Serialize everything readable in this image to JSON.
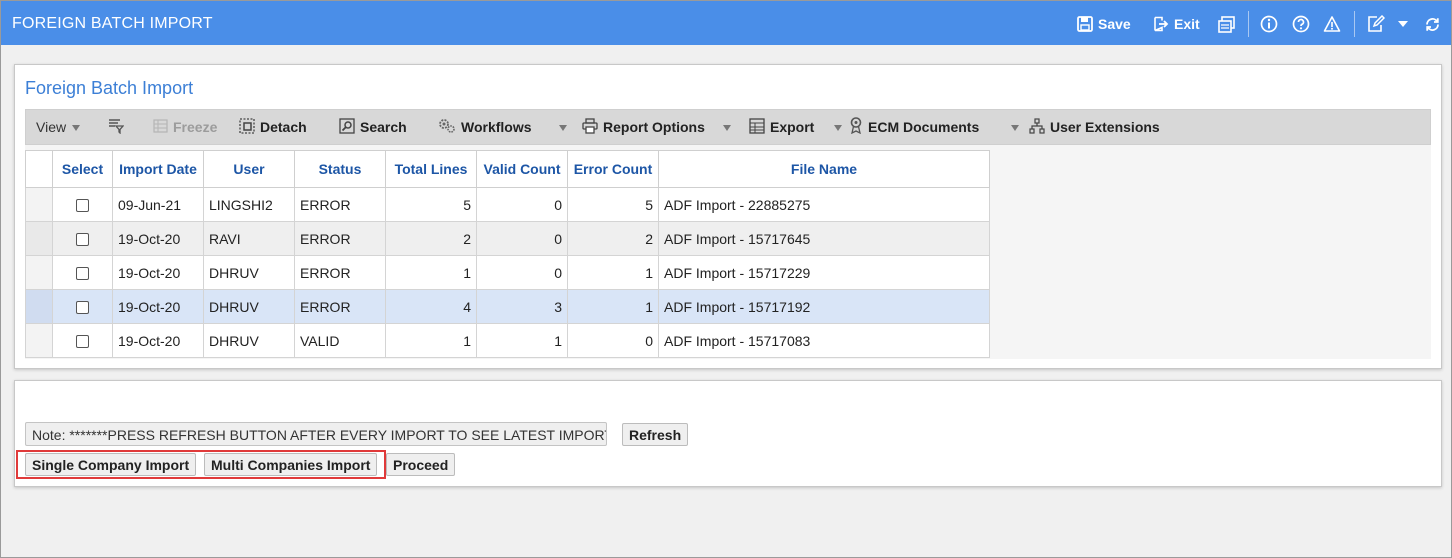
{
  "window": {
    "title": "FOREIGN BATCH IMPORT",
    "save_label": "Save",
    "exit_label": "Exit"
  },
  "panel": {
    "title": "Foreign Batch Import"
  },
  "toolbar": {
    "view": "View",
    "freeze": "Freeze",
    "detach": "Detach",
    "search": "Search",
    "workflows": "Workflows",
    "report_options": "Report Options",
    "export": "Export",
    "ecm_documents": "ECM Documents",
    "user_extensions": "User Extensions"
  },
  "table": {
    "columns": [
      "Select",
      "Import Date",
      "User",
      "Status",
      "Total Lines",
      "Valid Count",
      "Error Count",
      "File Name"
    ],
    "rows": [
      {
        "import_date": "09-Jun-21",
        "user": "LINGSHI2",
        "status": "ERROR",
        "total_lines": "5",
        "valid_count": "0",
        "error_count": "5",
        "file_name": "ADF Import - 22885275"
      },
      {
        "import_date": "19-Oct-20",
        "user": "RAVI",
        "status": "ERROR",
        "total_lines": "2",
        "valid_count": "0",
        "error_count": "2",
        "file_name": "ADF Import - 15717645"
      },
      {
        "import_date": "19-Oct-20",
        "user": "DHRUV",
        "status": "ERROR",
        "total_lines": "1",
        "valid_count": "0",
        "error_count": "1",
        "file_name": "ADF Import - 15717229"
      },
      {
        "import_date": "19-Oct-20",
        "user": "DHRUV",
        "status": "ERROR",
        "total_lines": "4",
        "valid_count": "3",
        "error_count": "1",
        "file_name": "ADF Import - 15717192"
      },
      {
        "import_date": "19-Oct-20",
        "user": "DHRUV",
        "status": "VALID",
        "total_lines": "1",
        "valid_count": "1",
        "error_count": "0",
        "file_name": "ADF Import - 15717083"
      }
    ]
  },
  "bottom": {
    "note": "Note: *******PRESS REFRESH BUTTON AFTER EVERY IMPORT TO SEE LATEST IMPORT",
    "refresh_label": "Refresh",
    "single_company_label": "Single Company Import",
    "multi_companies_label": "Multi Companies Import",
    "proceed_label": "Proceed"
  },
  "colors": {
    "titlebar": "#4a8ee8",
    "panel_title": "#3c7fd6",
    "header_text": "#1d56a6",
    "selected_row": "#d9e5f7",
    "highlight_border": "#e03a3a"
  }
}
